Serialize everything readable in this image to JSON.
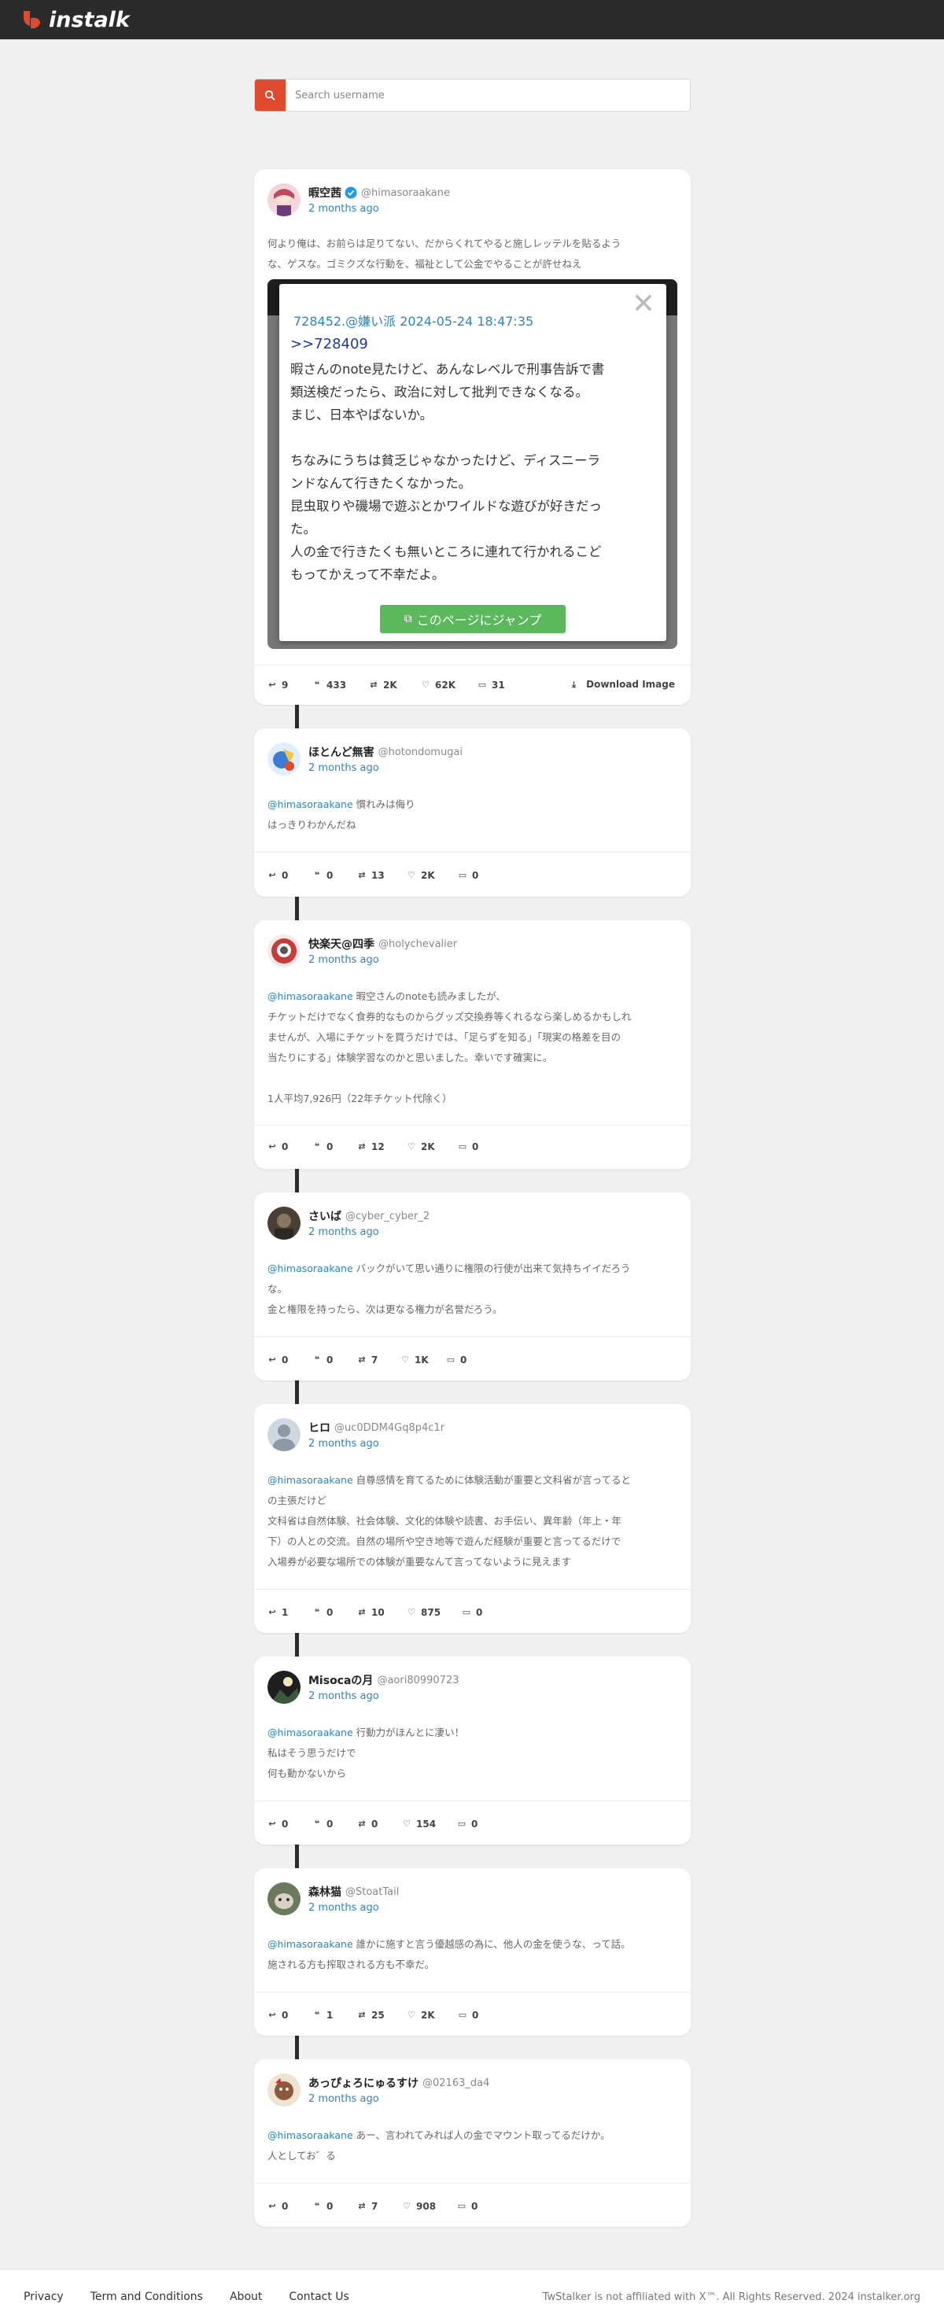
{
  "brand": {
    "name": "instalk",
    "accent": "#e04a2f"
  },
  "search": {
    "placeholder": "Search username"
  },
  "posts": [
    {
      "name": "暇空茜",
      "verified": true,
      "handle": "@himasoraakane",
      "time": "2 months ago",
      "lines": [
        "何より俺は、お前らは足りてない、だからくれてやると施しレッテルを貼るよう",
        "な、ゲスな。ゴミクズな行動を、福祉として公金でやることが許せねえ"
      ],
      "media": {
        "header": "728452.@嫌い派 2024-05-24 18:47:35",
        "ref": ">>728409",
        "body": [
          "暇さんのnote見たけど、あんなレベルで刑事告訴で書",
          "類送検だったら、政治に対して批判できなくなる。",
          "まじ、日本やばないか。",
          "",
          "ちなみにうちは貧乏じゃなかったけど、ディスニーラ",
          "ンドなんて行きたくなかった。",
          "昆虫取りや磯場で遊ぶとかワイルドな遊びが好きだっ",
          "た。",
          "人の金で行きたくも無いところに連れて行かれるこど",
          "もってかえって不幸だよ。"
        ],
        "jump": "このページにジャンプ",
        "close": "✕"
      },
      "stats": [
        "9",
        "433",
        "2K",
        "62K",
        "31"
      ],
      "download": "Download Image"
    },
    {
      "name": "ほとんど無害",
      "handle": "@hotondomugai",
      "time": "2 months ago",
      "mention": "@himasoraakane",
      "lines": [
        "慣れみは侮り",
        "はっきりわかんだね"
      ],
      "stats": [
        "0",
        "0",
        "13",
        "2K",
        "0"
      ]
    },
    {
      "name": "快楽天@四季",
      "handle": "@holychevalier",
      "time": "2 months ago",
      "mention": "@himasoraakane",
      "lines": [
        "暇空さんのnoteも読みましたが、",
        "チケットだけでなく食券的なものからグッズ交換券等くれるなら楽しめるかもしれ",
        "ませんが、入場にチケットを買うだけでは、「足らずを知る」「現実の格差を目の",
        "当たりにする」体験学習なのかと思いました。幸いです確実に。",
        "",
        "1人平均7,926円（22年チケット代除く）"
      ],
      "stats": [
        "0",
        "0",
        "12",
        "2K",
        "0"
      ]
    },
    {
      "name": "さいば",
      "handle": "@cyber_cyber_2",
      "time": "2 months ago",
      "mention": "@himasoraakane",
      "lines": [
        "バックがいて思い通りに権限の行使が出来て気持ちイイだろう",
        "な。",
        "金と権限を持ったら、次は更なる権力が名誉だろう。"
      ],
      "stats": [
        "0",
        "0",
        "7",
        "1K",
        "0"
      ]
    },
    {
      "name": "ヒロ",
      "handle": "@uc0DDM4Gq8p4c1r",
      "time": "2 months ago",
      "mention": "@himasoraakane",
      "lines": [
        "自尊感情を育てるために体験活動が重要と文科省が言ってると",
        "の主張だけど",
        "文科省は自然体験、社会体験、文化的体験や読書、お手伝い、異年齢（年上・年",
        "下）の人との交流。自然の場所や空き地等で遊んだ経験が重要と言ってるだけで",
        "入場券が必要な場所での体験が重要なんて言ってないように見えます"
      ],
      "stats": [
        "1",
        "0",
        "10",
        "875",
        "0"
      ]
    },
    {
      "name": "Misocaの月",
      "handle": "@aori80990723",
      "time": "2 months ago",
      "mention": "@himasoraakane",
      "lines": [
        "行動力がほんとに凄い！",
        "私はそう思うだけで",
        "何も動かないから"
      ],
      "stats": [
        "0",
        "0",
        "0",
        "154",
        "0"
      ]
    },
    {
      "name": "森林猫",
      "handle": "@StoatTail",
      "time": "2 months ago",
      "mention": "@himasoraakane",
      "lines": [
        "誰かに施すと言う優越感の為に、他人の金を使うな、って話。",
        "施される方も搾取される方も不幸だ。"
      ],
      "stats": [
        "0",
        "1",
        "25",
        "2K",
        "0"
      ]
    },
    {
      "name": "あっぴょろにゅるすけ",
      "handle": "@02163_da4",
      "time": "2 months ago",
      "mention": "@himasoraakane",
      "lines": [
        "あー、言われてみれば人の金でマウント取ってるだけか。",
        "人としてお゛る"
      ],
      "stats": [
        "0",
        "0",
        "7",
        "908",
        "0"
      ]
    }
  ],
  "footer": {
    "links": [
      "Privacy",
      "Term and Conditions",
      "About",
      "Contact Us"
    ],
    "copyright": "TwStalker is not affiliated with X™. All Rights Reserved.  2024 instalker.org"
  },
  "icons": {
    "search": "search-icon",
    "reply": "reply-icon",
    "quote": "quote-icon",
    "retweet": "retweet-icon",
    "like": "heart-icon",
    "bookmark": "bookmark-icon",
    "download": "download-icon",
    "verified": "verified-badge-icon",
    "jump": "external-link-icon"
  }
}
